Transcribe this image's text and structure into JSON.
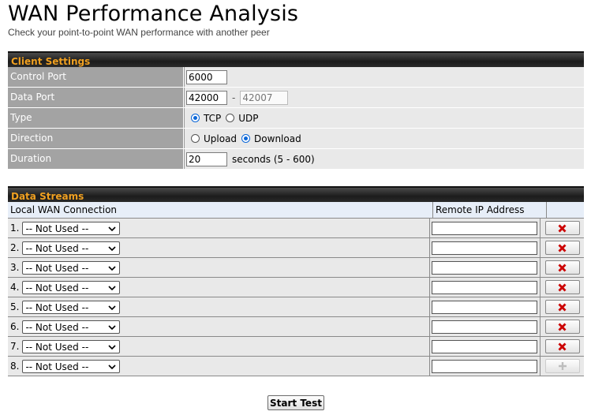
{
  "page": {
    "title": "WAN Performance Analysis",
    "subtitle": "Check your point-to-point WAN performance with another peer"
  },
  "client_settings": {
    "heading": "Client Settings",
    "control_port": {
      "label": "Control Port",
      "value": "6000"
    },
    "data_port": {
      "label": "Data Port",
      "value": "42000",
      "separator": "-",
      "end_value": "42007"
    },
    "type": {
      "label": "Type",
      "options": [
        "TCP",
        "UDP"
      ],
      "selected": "TCP"
    },
    "direction": {
      "label": "Direction",
      "options": [
        "Upload",
        "Download"
      ],
      "selected": "Download"
    },
    "duration": {
      "label": "Duration",
      "value": "20",
      "suffix": "seconds (5 - 600)"
    }
  },
  "data_streams": {
    "heading": "Data Streams",
    "columns": [
      "Local WAN Connection",
      "Remote IP Address",
      ""
    ],
    "rows": [
      {
        "index": "1.",
        "connection": "-- Not Used --",
        "remote_ip": "",
        "action": "remove"
      },
      {
        "index": "2.",
        "connection": "-- Not Used --",
        "remote_ip": "",
        "action": "remove"
      },
      {
        "index": "3.",
        "connection": "-- Not Used --",
        "remote_ip": "",
        "action": "remove"
      },
      {
        "index": "4.",
        "connection": "-- Not Used --",
        "remote_ip": "",
        "action": "remove"
      },
      {
        "index": "5.",
        "connection": "-- Not Used --",
        "remote_ip": "",
        "action": "remove"
      },
      {
        "index": "6.",
        "connection": "-- Not Used --",
        "remote_ip": "",
        "action": "remove"
      },
      {
        "index": "7.",
        "connection": "-- Not Used --",
        "remote_ip": "",
        "action": "remove"
      },
      {
        "index": "8.",
        "connection": "-- Not Used --",
        "remote_ip": "",
        "action": "add"
      }
    ]
  },
  "actions": {
    "start_label": "Start Test"
  },
  "colors": {
    "accent": "#f0a020",
    "remove": "#cc0000",
    "radio": "#0a66d8"
  }
}
